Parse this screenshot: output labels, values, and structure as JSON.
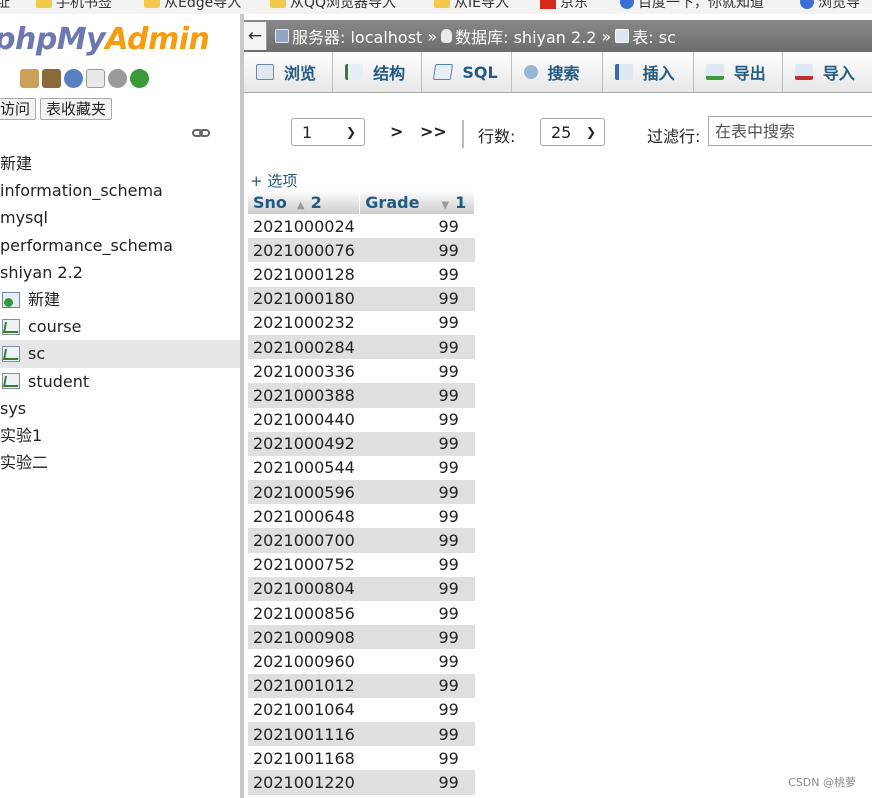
{
  "bookmarks": [
    {
      "label": "址",
      "icon": "none"
    },
    {
      "label": "手机书签",
      "icon": "folder-icon"
    },
    {
      "label": "从Edge导入",
      "icon": "folder-icon"
    },
    {
      "label": "从QQ浏览器导入",
      "icon": "folder-icon"
    },
    {
      "label": "从IE导入",
      "icon": "folder-icon"
    },
    {
      "label": "京东",
      "icon": "jd-icon"
    },
    {
      "label": "百度一下，你就知道",
      "icon": "baidu-icon"
    },
    {
      "label": "浏览导",
      "icon": "edge-icon"
    }
  ],
  "nav": {
    "logo_part1": "phpMy",
    "logo_part2": "Admin",
    "icons": [
      "home-icon",
      "exit-icon",
      "help-icon",
      "docs-icon",
      "settings-icon",
      "reload-icon"
    ],
    "tab_recent": "访问",
    "tab_favorites": "表收藏夹",
    "link_icon": "link-icon",
    "tree": [
      {
        "label": "新建",
        "type": "text"
      },
      {
        "label": "information_schema",
        "type": "text"
      },
      {
        "label": "mysql",
        "type": "text"
      },
      {
        "label": "performance_schema",
        "type": "text"
      },
      {
        "label": "shiyan 2.2",
        "type": "text"
      },
      {
        "label": "新建",
        "type": "newtable"
      },
      {
        "label": "course",
        "type": "table"
      },
      {
        "label": "sc",
        "type": "table",
        "selected": true
      },
      {
        "label": "student",
        "type": "table"
      },
      {
        "label": "sys",
        "type": "text"
      },
      {
        "label": "实验1",
        "type": "text"
      },
      {
        "label": "实验二",
        "type": "text"
      }
    ]
  },
  "breadcrumb": {
    "back": "←",
    "server": "服务器: localhost",
    "database": "数据库: shiyan 2.2",
    "table": "表: sc",
    "sep": "»"
  },
  "tabs": [
    {
      "label": "浏览",
      "icon": "browse-icon"
    },
    {
      "label": "结构",
      "icon": "structure-icon"
    },
    {
      "label": "SQL",
      "icon": "sql-icon"
    },
    {
      "label": "搜索",
      "icon": "search-icon"
    },
    {
      "label": "插入",
      "icon": "insert-icon"
    },
    {
      "label": "导出",
      "icon": "export-icon"
    },
    {
      "label": "导入",
      "icon": "import-icon"
    }
  ],
  "controls": {
    "page_value": "1",
    "next": ">",
    "last": ">>",
    "rows_label": "行数:",
    "rows_value": "25",
    "filter_label": "过滤行:",
    "filter_placeholder": "在表中搜索"
  },
  "options_link": "+ 选项",
  "table": {
    "columns": [
      {
        "name": "Sno",
        "sort_dir": "▲",
        "sort_order": "2"
      },
      {
        "name": "Grade",
        "sort_dir": "▼",
        "sort_order": "1"
      }
    ],
    "rows": [
      [
        "2021000024",
        "99"
      ],
      [
        "2021000076",
        "99"
      ],
      [
        "2021000128",
        "99"
      ],
      [
        "2021000180",
        "99"
      ],
      [
        "2021000232",
        "99"
      ],
      [
        "2021000284",
        "99"
      ],
      [
        "2021000336",
        "99"
      ],
      [
        "2021000388",
        "99"
      ],
      [
        "2021000440",
        "99"
      ],
      [
        "2021000492",
        "99"
      ],
      [
        "2021000544",
        "99"
      ],
      [
        "2021000596",
        "99"
      ],
      [
        "2021000648",
        "99"
      ],
      [
        "2021000700",
        "99"
      ],
      [
        "2021000752",
        "99"
      ],
      [
        "2021000804",
        "99"
      ],
      [
        "2021000856",
        "99"
      ],
      [
        "2021000908",
        "99"
      ],
      [
        "2021000960",
        "99"
      ],
      [
        "2021001012",
        "99"
      ],
      [
        "2021001064",
        "99"
      ],
      [
        "2021001116",
        "99"
      ],
      [
        "2021001168",
        "99"
      ],
      [
        "2021001220",
        "99"
      ]
    ]
  },
  "watermark": "CSDN @桃萝",
  "colors": {
    "link_blue": "#235a81",
    "logo_blue": "#6c78af",
    "logo_orange": "#f89c0e",
    "row_alt": "#dfdfdf",
    "crumb_bg": "#7a7a7a"
  }
}
